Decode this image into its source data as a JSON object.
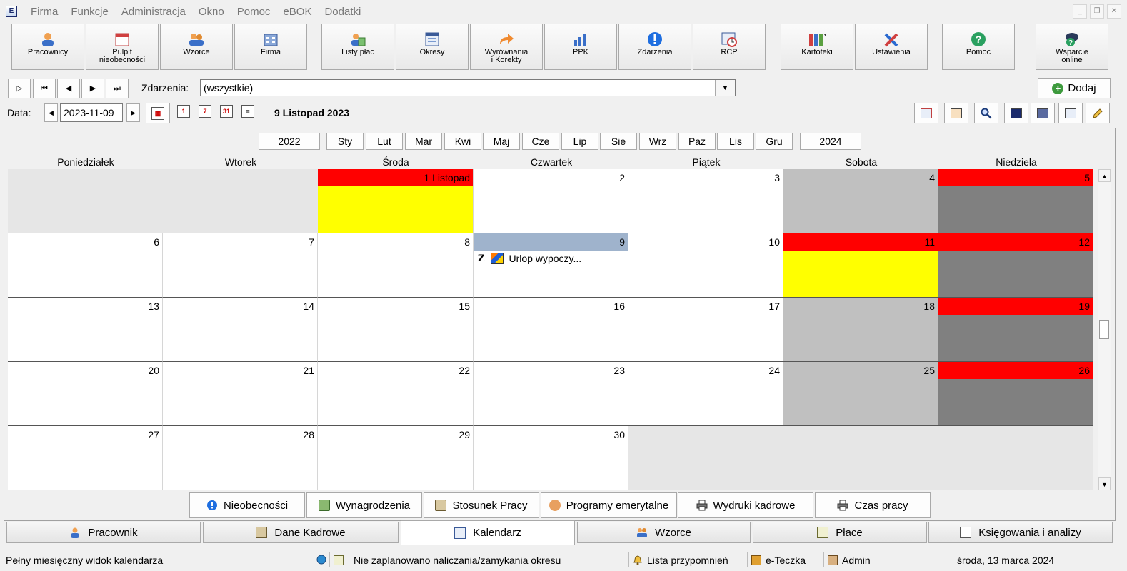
{
  "menu": [
    "Firma",
    "Funkcje",
    "Administracja",
    "Okno",
    "Pomoc",
    "eBOK",
    "Dodatki"
  ],
  "toolbar": [
    {
      "label": "Pracownicy",
      "icon": "user-icon"
    },
    {
      "label": "Pulpit\nnieobecności",
      "icon": "calendar-desk-icon"
    },
    {
      "label": "Wzorce",
      "icon": "users-template-icon"
    },
    {
      "label": "Firma",
      "icon": "building-icon"
    },
    {
      "label": "Listy płac",
      "icon": "payroll-icon"
    },
    {
      "label": "Okresy",
      "icon": "periods-icon"
    },
    {
      "label": "Wyrównania\ni Korekty",
      "icon": "corrections-arrow-icon"
    },
    {
      "label": "PPK",
      "icon": "bar-chart-icon"
    },
    {
      "label": "Zdarzenia",
      "icon": "info-icon"
    },
    {
      "label": "RCP",
      "icon": "clock-calendar-icon"
    },
    {
      "label": "Kartoteki",
      "icon": "binders-icon"
    },
    {
      "label": "Ustawienia",
      "icon": "tools-icon"
    },
    {
      "label": "Pomoc",
      "icon": "help-icon"
    },
    {
      "label": "Wsparcie\nonline",
      "icon": "support-icon"
    }
  ],
  "nav": {
    "events_label": "Zdarzenia:",
    "events_value": "(wszystkie)",
    "add_label": "Dodaj"
  },
  "date": {
    "label": "Data:",
    "value": "2023-11-09",
    "title": "9 Listopad 2023"
  },
  "months": {
    "prev_year": "2022",
    "next_year": "2024",
    "items": [
      "Sty",
      "Lut",
      "Mar",
      "Kwi",
      "Maj",
      "Cze",
      "Lip",
      "Sie",
      "Wrz",
      "Paz",
      "Lis",
      "Gru"
    ]
  },
  "weekdays": [
    "Poniedziałek",
    "Wtorek",
    "Środa",
    "Czwartek",
    "Piątek",
    "Sobota",
    "Niedziela"
  ],
  "calendar": {
    "weeks": [
      [
        null,
        null,
        {
          "day": "1 Listopad",
          "hdr": "#ff0000",
          "body": "#ffff00"
        },
        {
          "day": "2"
        },
        {
          "day": "3"
        },
        {
          "day": "4",
          "hdr": "#c0c0c0",
          "body": "#c0c0c0"
        },
        {
          "day": "5",
          "hdr": "#ff0000",
          "body": "#808080"
        }
      ],
      [
        {
          "day": "6"
        },
        {
          "day": "7"
        },
        {
          "day": "8"
        },
        {
          "day": "9",
          "hdr": "#9fb3cc",
          "event": {
            "mark": "Z",
            "text": "Urlop wypoczy..."
          }
        },
        {
          "day": "10"
        },
        {
          "day": "11",
          "hdr": "#ff0000",
          "body": "#ffff00"
        },
        {
          "day": "12",
          "hdr": "#ff0000",
          "body": "#808080"
        }
      ],
      [
        {
          "day": "13"
        },
        {
          "day": "14"
        },
        {
          "day": "15"
        },
        {
          "day": "16"
        },
        {
          "day": "17"
        },
        {
          "day": "18",
          "hdr": "#c0c0c0",
          "body": "#c0c0c0"
        },
        {
          "day": "19",
          "hdr": "#ff0000",
          "body": "#808080"
        }
      ],
      [
        {
          "day": "20"
        },
        {
          "day": "21"
        },
        {
          "day": "22"
        },
        {
          "day": "23"
        },
        {
          "day": "24"
        },
        {
          "day": "25",
          "hdr": "#c0c0c0",
          "body": "#c0c0c0"
        },
        {
          "day": "26",
          "hdr": "#ff0000",
          "body": "#808080"
        }
      ],
      [
        {
          "day": "27"
        },
        {
          "day": "28"
        },
        {
          "day": "29"
        },
        {
          "day": "30"
        },
        null,
        null,
        null
      ]
    ]
  },
  "bottom_buttons": [
    {
      "label": "Nieobecności",
      "icon": "info-icon"
    },
    {
      "label": "Wynagrodzenia",
      "icon": "salary-icon"
    },
    {
      "label": "Stosunek Pracy",
      "icon": "contract-icon"
    },
    {
      "label": "Programy emerytalne",
      "icon": "pension-icon"
    },
    {
      "label": "Wydruki kadrowe",
      "icon": "printer-icon"
    },
    {
      "label": "Czas pracy",
      "icon": "printer-icon"
    }
  ],
  "tabs": [
    {
      "label": "Pracownik",
      "icon": "user-icon"
    },
    {
      "label": "Dane Kadrowe",
      "icon": "hr-data-icon"
    },
    {
      "label": "Kalendarz",
      "icon": "calendar-icon",
      "active": true
    },
    {
      "label": "Wzorce",
      "icon": "users-template-icon"
    },
    {
      "label": "Płace",
      "icon": "calculator-icon"
    },
    {
      "label": "Księgowania i analizy",
      "icon": "ledger-icon"
    }
  ],
  "status": {
    "hint": "Pełny miesięczny widok kalendarza",
    "period": "Nie zaplanowano naliczania/zamykania okresu",
    "reminders": "Lista przypomnień",
    "eteczka": "e-Teczka",
    "user": "Admin",
    "today": "środa, 13 marca 2024"
  },
  "colors": {
    "holiday_red": "#ff0000",
    "free_day_yellow": "#ffff00",
    "weekend_gray": "#c0c0c0",
    "sunday_dark": "#808080",
    "selected_day": "#9fb3cc"
  }
}
